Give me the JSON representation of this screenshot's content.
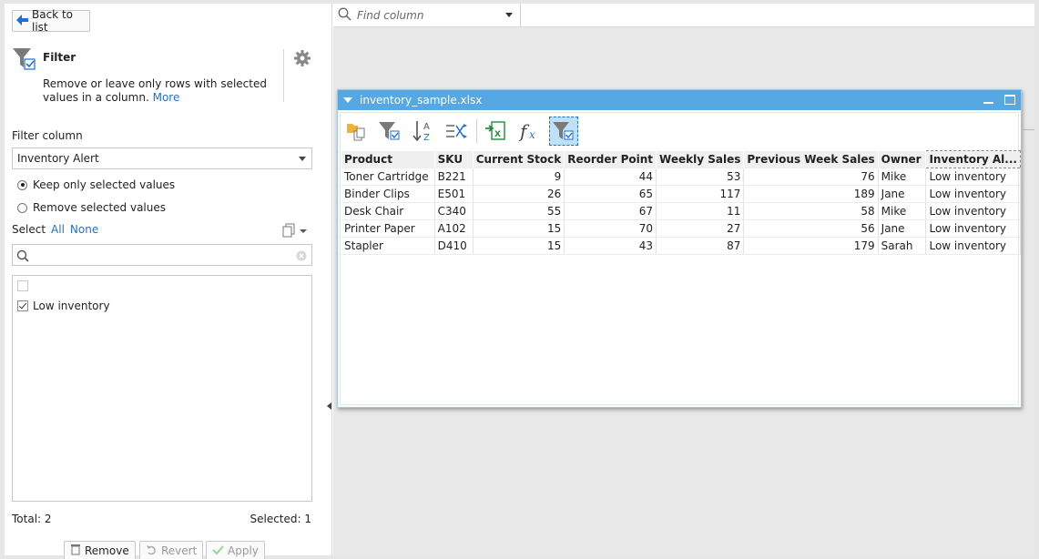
{
  "sidebar": {
    "back_label": "Back to list",
    "filter_title": "Filter",
    "description": "Remove or leave only rows with selected values in a column.",
    "more_link": "More",
    "filter_column_label": "Filter column",
    "filter_column_value": "Inventory Alert",
    "radio_keep": "Keep only selected values",
    "radio_remove": "Remove selected values",
    "radio_selected": "keep",
    "select_label": "Select",
    "select_all": "All",
    "select_none": "None",
    "search_placeholder": "",
    "values": [
      {
        "label": "",
        "checked": false
      },
      {
        "label": "Low inventory",
        "checked": true
      }
    ],
    "total": "Total: 2",
    "selected": "Selected: 1",
    "remove_label": "Remove",
    "revert_label": "Revert",
    "apply_label": "Apply"
  },
  "find_column": {
    "placeholder": "Find column"
  },
  "node": {
    "title": "inventory_sample.xlsx",
    "columns": [
      "Product",
      "SKU",
      "Current Stock",
      "Reorder Point",
      "Weekly Sales",
      "Previous Week Sales",
      "Owner",
      "Inventory Al..."
    ],
    "rows": [
      [
        "Toner Cartridge",
        "B221",
        "9",
        "44",
        "53",
        "76",
        "Mike",
        "Low inventory"
      ],
      [
        "Binder Clips",
        "E501",
        "26",
        "65",
        "117",
        "189",
        "Jane",
        "Low inventory"
      ],
      [
        "Desk Chair",
        "C340",
        "55",
        "67",
        "11",
        "58",
        "Mike",
        "Low inventory"
      ],
      [
        "Printer Paper",
        "A102",
        "15",
        "70",
        "27",
        "56",
        "Jane",
        "Low inventory"
      ],
      [
        "Stapler",
        "D410",
        "15",
        "43",
        "87",
        "179",
        "Sarah",
        "Low inventory"
      ]
    ]
  },
  "colors": {
    "accent": "#1f6fd1",
    "node_header": "#56a8e3"
  }
}
